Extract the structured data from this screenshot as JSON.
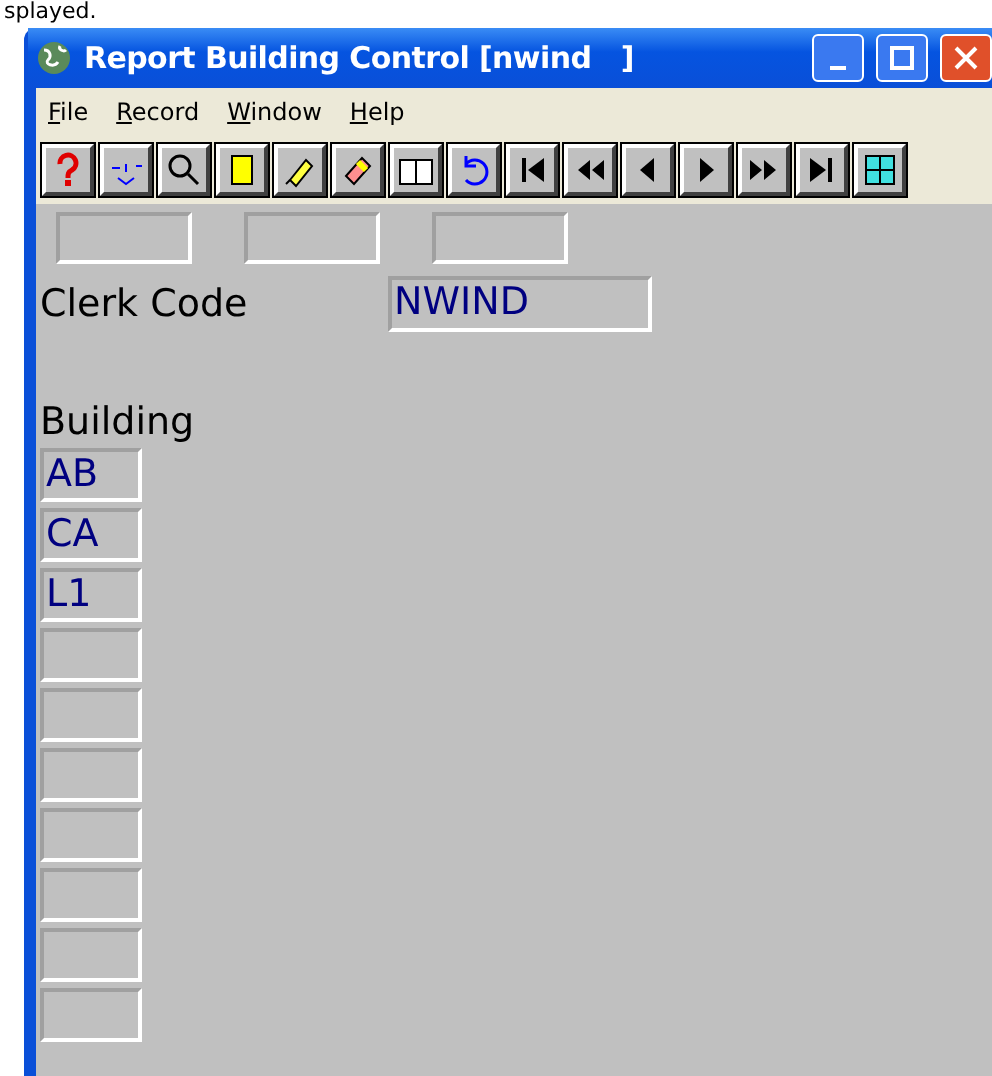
{
  "top_text": "splayed.",
  "window": {
    "title": "Report Building Control [nwind   ]"
  },
  "menu": [
    {
      "label": "File"
    },
    {
      "label": "Record"
    },
    {
      "label": "Window"
    },
    {
      "label": "Help"
    }
  ],
  "clerk": {
    "label": "Clerk Code",
    "value": "NWIND"
  },
  "building": {
    "label": "Building",
    "values": [
      "AB",
      "CA",
      "L1"
    ]
  }
}
